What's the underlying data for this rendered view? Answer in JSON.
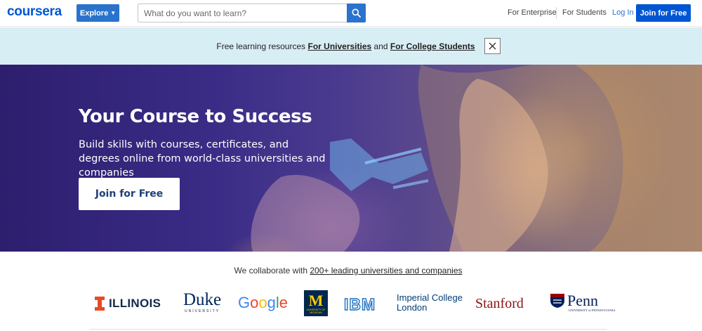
{
  "header": {
    "logo": "coursera",
    "explore_label": "Explore",
    "search_placeholder": "What do you want to learn?",
    "nav": {
      "enterprise": "For Enterprise",
      "students": "For Students",
      "login": "Log In",
      "join": "Join for Free"
    }
  },
  "banner": {
    "text_prefix": "Free learning resources",
    "link_universities": "For Universities",
    "text_and": "and",
    "link_students": "For College Students"
  },
  "hero": {
    "title": "Your Course to Success",
    "subtitle": "Build skills with courses, certificates, and degrees online from world-class universities and companies",
    "cta": "Join for Free"
  },
  "partners": {
    "intro_prefix": "We collaborate with",
    "intro_link": "200+ leading universities and companies",
    "logos": {
      "illinois": "ILLINOIS",
      "duke": "Duke",
      "duke_sub": "UNIVERSITY",
      "google": "Google",
      "michigan_mark": "M",
      "michigan_sub": "UNIVERSITY OF MICHIGAN",
      "ibm": "IBM",
      "imperial_line1": "Imperial College",
      "imperial_line2": "London",
      "stanford": "Stanford",
      "penn": "Penn",
      "penn_sub": "UNIVERSITY of PENNSYLVANIA"
    }
  },
  "colors": {
    "brand": "#0056d2",
    "banner_bg": "#d8eef5",
    "hero_dark": "#2d1e6e"
  }
}
